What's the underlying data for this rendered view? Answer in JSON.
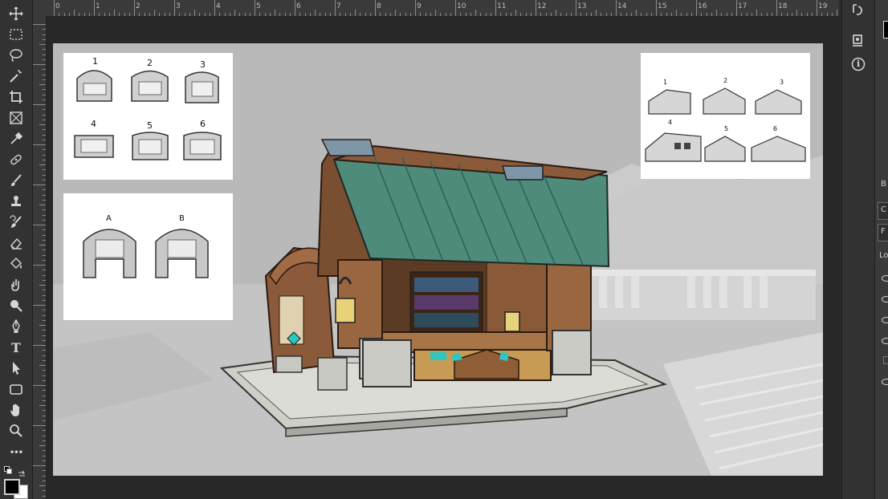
{
  "toolbar": {
    "tools": [
      {
        "name": "move-tool",
        "icon": "move-icon"
      },
      {
        "name": "marquee-tool",
        "icon": "rectangle-marquee-icon"
      },
      {
        "name": "lasso-tool",
        "icon": "lasso-icon"
      },
      {
        "name": "magic-wand-tool",
        "icon": "magic-wand-icon"
      },
      {
        "name": "crop-tool",
        "icon": "crop-icon"
      },
      {
        "name": "frame-tool",
        "icon": "frame-icon"
      },
      {
        "name": "eyedropper-tool",
        "icon": "eyedropper-icon"
      },
      {
        "name": "healing-brush-tool",
        "icon": "bandage-icon"
      },
      {
        "name": "brush-tool",
        "icon": "brush-icon"
      },
      {
        "name": "stamp-tool",
        "icon": "stamp-icon"
      },
      {
        "name": "history-brush-tool",
        "icon": "history-brush-icon"
      },
      {
        "name": "eraser-tool",
        "icon": "eraser-icon"
      },
      {
        "name": "paint-bucket-tool",
        "icon": "paint-bucket-icon"
      },
      {
        "name": "smudge-tool",
        "icon": "smudge-icon"
      },
      {
        "name": "dodge-tool",
        "icon": "dodge-icon"
      },
      {
        "name": "pen-tool",
        "icon": "pen-icon"
      },
      {
        "name": "type-tool",
        "icon": "type-icon"
      },
      {
        "name": "path-selection-tool",
        "icon": "arrow-icon"
      },
      {
        "name": "shape-tool",
        "icon": "rectangle-icon"
      },
      {
        "name": "hand-tool",
        "icon": "hand-icon"
      },
      {
        "name": "zoom-tool",
        "icon": "zoom-icon"
      },
      {
        "name": "more-tools",
        "icon": "ellipsis-icon"
      }
    ],
    "type_glyph": "T",
    "more_glyph": "•••",
    "foreground_color": "#000000",
    "background_color": "#ffffff"
  },
  "ruler": {
    "labels": [
      "0",
      "1",
      "2",
      "3",
      "4",
      "5",
      "6",
      "7",
      "8",
      "9",
      "10",
      "11",
      "12",
      "13",
      "14",
      "15",
      "16",
      "17",
      "18",
      "19"
    ]
  },
  "sketches": {
    "left_top_numbers": [
      "1",
      "2",
      "3",
      "4",
      "5",
      "6"
    ],
    "left_bottom_letters": [
      "A",
      "B"
    ],
    "right_top_numbers": [
      "1",
      "2",
      "3",
      "4",
      "5",
      "6"
    ]
  },
  "colors": {
    "roof": "#4f8b7a",
    "wood": "#8a5a3a",
    "stone": "#c9c9c4",
    "accent_cyan": "#2fc6c0",
    "lantern": "#e8d27a",
    "background_scene": "#b4b4b4"
  },
  "right_panel": {
    "icons": [
      "history-icon",
      "3d-icon",
      "info-icon"
    ],
    "info_glyph": "i"
  },
  "far_panel": {
    "labels": [
      "B",
      "C",
      "F",
      "Lo"
    ]
  }
}
